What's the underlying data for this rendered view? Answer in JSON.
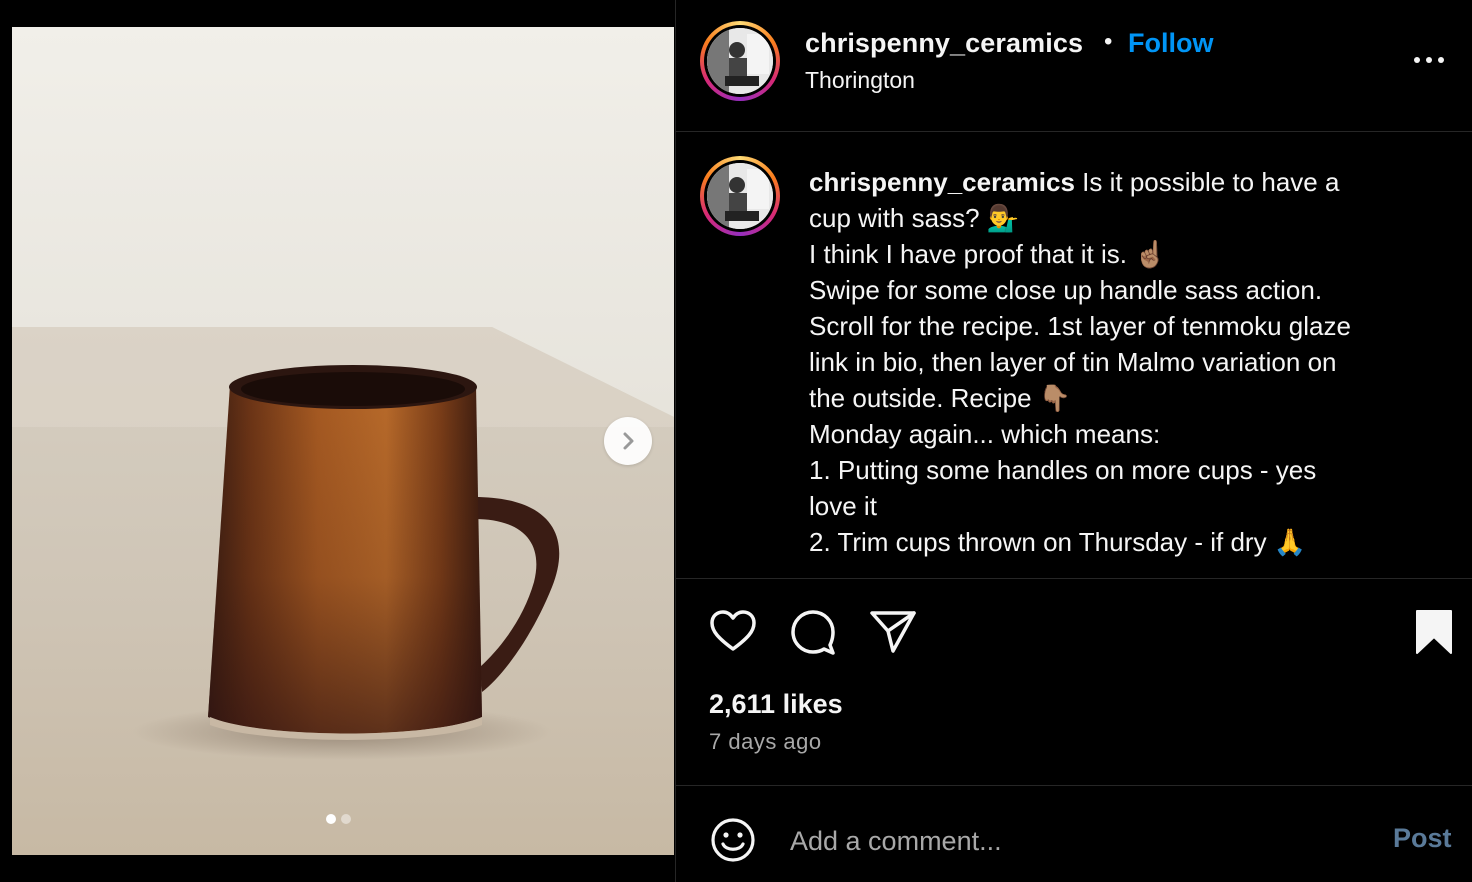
{
  "post": {
    "image_alt": "Handmade ceramic mug with tenmoku glaze",
    "carousel": {
      "slide_count": 2,
      "active_index": 0
    }
  },
  "header": {
    "username": "chrispenny_ceramics",
    "separator": "•",
    "follow_label": "Follow",
    "location": "Thorington",
    "more_label": "..."
  },
  "caption": {
    "username": "chrispenny_ceramics",
    "lines": [
      " Is it possible to have a",
      "cup with sass? 💁‍♂️",
      "I think I have proof that it is. ☝🏽",
      "Swipe for some close up handle sass action.",
      "Scroll for the recipe. 1st layer of tenmoku glaze",
      "link in bio, then layer of tin Malmo variation on",
      "the outside. Recipe 👇🏽",
      "Monday again... which means:",
      "1. Putting some handles on more cups - yes",
      "love it",
      "2. Trim cups thrown on Thursday - if dry 🙏"
    ]
  },
  "actions": {
    "likes": "2,611 likes",
    "timestamp": "7 days ago"
  },
  "comment": {
    "placeholder": "Add a comment...",
    "post_label": "Post"
  },
  "colors": {
    "background": "#000000",
    "link_blue": "#0095f6",
    "muted_text": "#a8a8a8",
    "divider": "#262626",
    "post_disabled": "#5a7a99"
  },
  "icons": {
    "like": "heart-icon",
    "comment": "comment-bubble-icon",
    "share": "paper-plane-icon",
    "save": "bookmark-icon",
    "emoji": "smiley-icon",
    "more": "ellipsis-icon",
    "next": "chevron-right-icon"
  }
}
